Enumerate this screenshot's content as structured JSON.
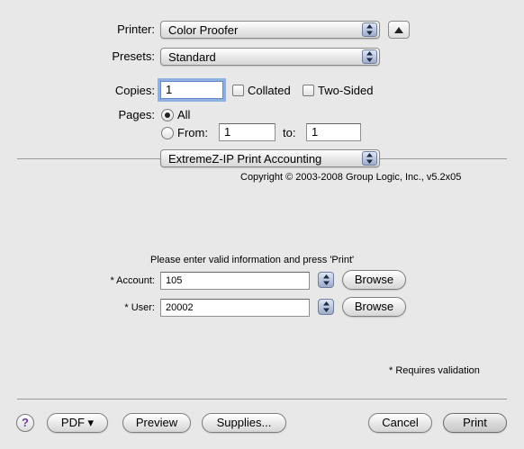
{
  "printer": {
    "label": "Printer:",
    "value": "Color Proofer"
  },
  "presets": {
    "label": "Presets:",
    "value": "Standard"
  },
  "copies": {
    "label": "Copies:",
    "value": "1",
    "collated_label": "Collated",
    "two_sided_label": "Two-Sided"
  },
  "pages": {
    "label": "Pages:",
    "all_label": "All",
    "from_label": "From:",
    "from_value": "1",
    "to_label": "to:",
    "to_value": "1"
  },
  "plugin": {
    "panel_menu": "ExtremeZ-IP Print Accounting",
    "copyright": "Copyright © 2003-2008 Group Logic, Inc., v5.2x05",
    "instruction": "Please enter valid information and press 'Print'",
    "account_label": "* Account:",
    "account_value": "105",
    "user_label": "* User:",
    "user_value": "20002",
    "browse_label": "Browse",
    "requires_note": "* Requires validation"
  },
  "footer": {
    "help": "?",
    "pdf": "PDF ▾",
    "preview": "Preview",
    "supplies": "Supplies...",
    "cancel": "Cancel",
    "print": "Print"
  }
}
